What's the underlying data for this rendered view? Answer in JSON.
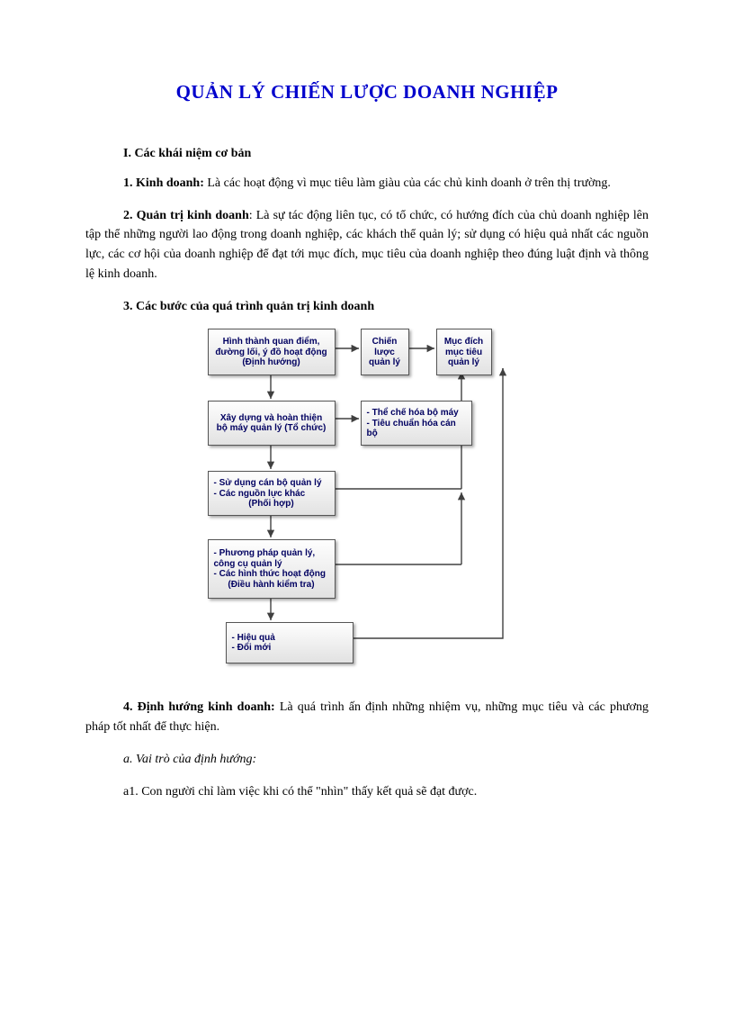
{
  "title": "QUẢN LÝ CHIẾN LƯỢC DOANH NGHIỆP",
  "section1": {
    "heading": "I. Các khái niệm cơ bản",
    "item1_label": "1. Kinh doanh:",
    "item1_text": " Là các hoạt động vì mục tiêu làm giàu của các chủ kinh doanh ở trên thị trường.",
    "item2_label": "2. Quản trị kinh doanh",
    "item2_text": ": Là sự tác động liên tục, có tổ chức, có hướng đích của chủ doanh nghiệp lên tập thể những người lao động trong doanh nghiệp, các khách thể quản lý; sử dụng có hiệu quả nhất các nguồn lực, các cơ hội của doanh nghiệp để đạt tới mục đích, mục tiêu của doanh nghiệp theo đúng luật định và thông lệ kinh doanh.",
    "item3_label": "3. Các bước của quá trình quản trị kinh doanh",
    "item4_label": "4. Định hướng kinh doanh:",
    "item4_text": " Là quá trình ấn định những nhiệm vụ, những mục tiêu và các phương pháp tốt nhất để thực hiện.",
    "sub_a": "a. Vai trò của định hướng:",
    "sub_a1": "a1. Con người chỉ làm việc khi có thể \"nhìn\"  thấy kết quả sẽ đạt được."
  },
  "diagram": {
    "b1": "Hình thành quan điểm, đường lối, ý đồ hoạt động (Định hướng)",
    "b2": "Chiến lược quản lý",
    "b3": "Mục đích mục tiêu quản lý",
    "b4": "Xây dựng và hoàn thiện bộ máy quản lý (Tổ chức)",
    "b5_l1": "- Thể chế hóa bộ máy",
    "b5_l2": "- Tiêu chuẩn hóa cán bộ",
    "b6_l1": "- Sử dụng cán bộ quản lý",
    "b6_l2": "- Các nguồn lực khác",
    "b6_l3": "(Phối hợp)",
    "b7_l1": "- Phương pháp quản lý, công cụ quản lý",
    "b7_l2": "- Các hình thức hoạt động",
    "b7_l3": "(Điều hành kiểm tra)",
    "b8_l1": "- Hiệu quả",
    "b8_l2": "- Đổi mới"
  }
}
